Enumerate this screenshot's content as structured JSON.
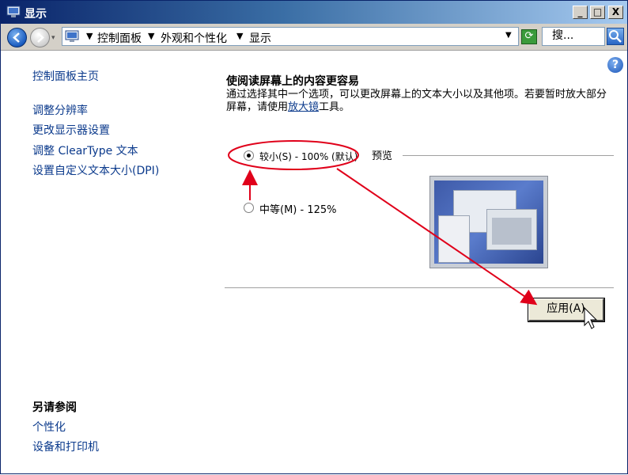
{
  "window": {
    "title": "显示",
    "minimize_label": "_",
    "maximize_label": "□",
    "close_label": "X"
  },
  "address": {
    "crumbs": [
      "控制面板",
      "外观和个性化",
      "显示"
    ],
    "search_placeholder": "搜..."
  },
  "sidebar": {
    "home": "控制面板主页",
    "links": [
      "调整分辨率",
      "更改显示器设置",
      "调整 ClearType 文本",
      "设置自定义文本大小(DPI)"
    ],
    "see_also_title": "另请参阅",
    "see_also": [
      "个性化",
      "设备和打印机"
    ]
  },
  "main": {
    "heading": "使阅读屏幕上的内容更容易",
    "desc_before": "通过选择其中一个选项，可以更改屏幕上的文本大小以及其他项。若要暂时放大部分屏幕，请使用",
    "desc_link": "放大镜",
    "desc_after": "工具。",
    "options": [
      {
        "label": "较小(S) - 100% (默认)",
        "selected": true
      },
      {
        "label": "中等(M) - 125%",
        "selected": false
      }
    ],
    "preview_label": "预览",
    "apply_label": "应用(A)"
  },
  "colors": {
    "title_bar": "#0a246a",
    "link": "#0b3a8c",
    "annotation": "#e0001a"
  },
  "icons": {
    "help": "?",
    "refresh": "⟳"
  }
}
